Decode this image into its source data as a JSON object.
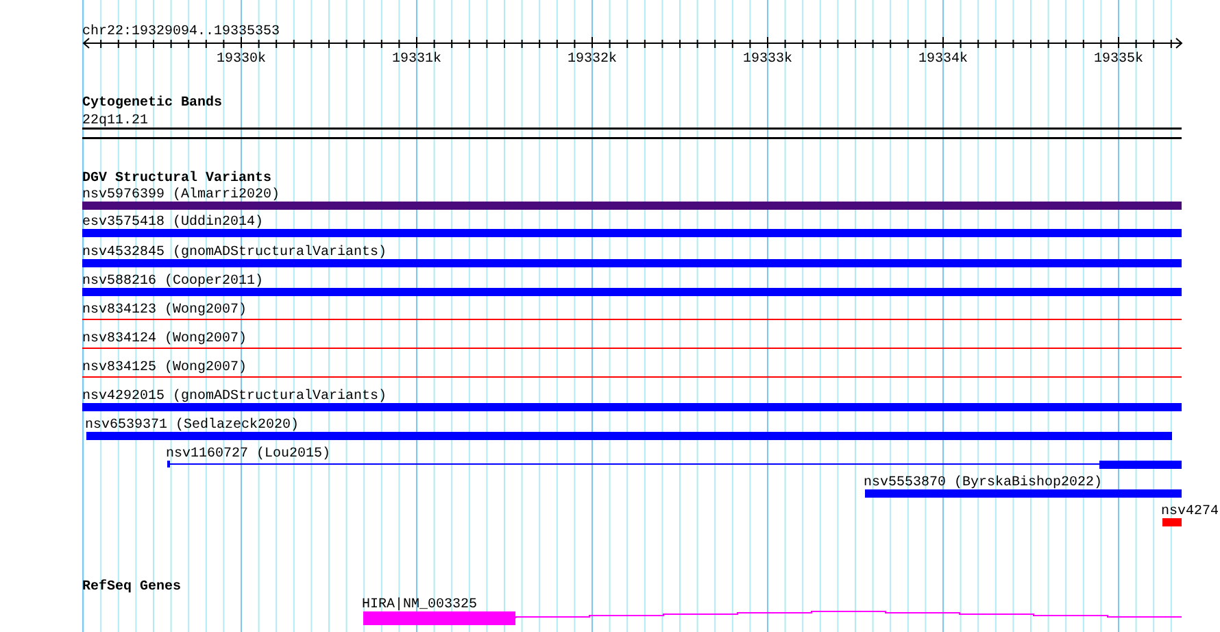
{
  "ruler": {
    "location": "chr22:19329094..19335353",
    "tick_labels": [
      "19330k",
      "19331k",
      "19332k",
      "19333k",
      "19334k",
      "19335k"
    ]
  },
  "tracks": [
    {
      "kind": "bands",
      "title": "Cytogenetic Bands",
      "features": [
        {
          "label": "22q11.21",
          "kind": "band"
        }
      ]
    },
    {
      "kind": "variants",
      "title": "DGV Structural Variants",
      "features": [
        {
          "label": "nsv5976399 (Almarri2020)",
          "kind": "bar",
          "color": "#4b0a7c"
        },
        {
          "label": "esv3575418 (Uddin2014)",
          "kind": "bar",
          "color": "#0000ff"
        },
        {
          "label": "nsv4532845 (gnomADStructuralVariants)",
          "kind": "bar",
          "color": "#0000ff"
        },
        {
          "label": "nsv588216 (Cooper2011)",
          "kind": "bar",
          "color": "#0000ff"
        },
        {
          "label": "nsv834123 (Wong2007)",
          "kind": "line",
          "color": "#ff0000"
        },
        {
          "label": "nsv834124 (Wong2007)",
          "kind": "line",
          "color": "#ff0000"
        },
        {
          "label": "nsv834125 (Wong2007)",
          "kind": "line",
          "color": "#ff0000"
        },
        {
          "label": "nsv4292015 (gnomADStructuralVariants)",
          "kind": "bar",
          "color": "#0000ff"
        },
        {
          "label": "nsv6539371 (Sedlazeck2020)",
          "kind": "bar",
          "color": "#0000ff"
        },
        {
          "label": "nsv1160727 (Lou2015)",
          "kind": "gapped",
          "color": "#0000ff"
        },
        {
          "label": "nsv5553870 (ByrskaBishop2022)",
          "kind": "bar",
          "color": "#0000ff"
        },
        {
          "label": "nsv4274",
          "kind": "bar",
          "color": "#ff0000"
        }
      ]
    },
    {
      "kind": "genes",
      "title": "RefSeq Genes",
      "features": [
        {
          "label": "HIRA|NM_003325",
          "kind": "gene",
          "color": "#ff00ff"
        }
      ]
    }
  ]
}
